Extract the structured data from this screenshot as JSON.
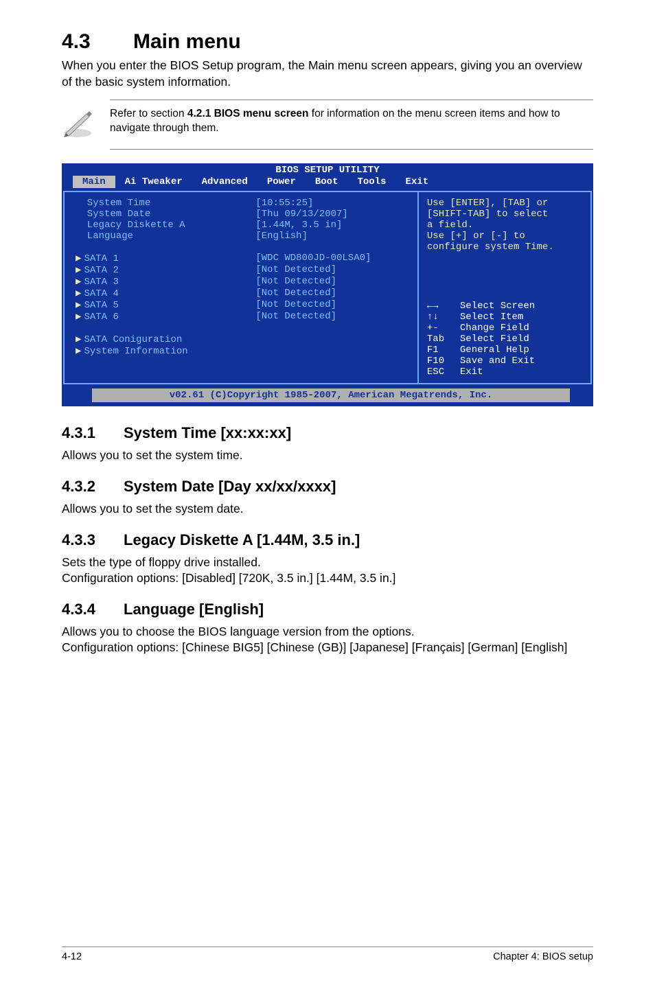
{
  "page": {
    "h2_num": "4.3",
    "h2_title": "Main menu",
    "intro": "When you enter the BIOS Setup program, the Main menu screen appears, giving you an overview of the basic system information.",
    "note_pre": "Refer to section ",
    "note_bold": "4.2.1  BIOS menu screen",
    "note_post": " for information on the menu screen items and how to navigate through them."
  },
  "bios": {
    "title": "BIOS SETUP UTILITY",
    "tabs": [
      "Main",
      "Ai Tweaker",
      "Advanced",
      "Power",
      "Boot",
      "Tools",
      "Exit"
    ],
    "selected_tab": "Main",
    "rows": [
      {
        "label": "System Time",
        "value": "[10:55:25]",
        "arrow": false
      },
      {
        "label": "System Date",
        "value": "[Thu 09/13/2007]",
        "arrow": false
      },
      {
        "label": "Legacy Diskette A",
        "value": "[1.44M, 3.5 in]",
        "arrow": false
      },
      {
        "label": "Language",
        "value": "[English]",
        "arrow": false
      },
      {
        "label": "",
        "value": "",
        "arrow": false
      },
      {
        "label": "SATA 1",
        "value": "[WDC WD800JD-00LSA0]",
        "arrow": true
      },
      {
        "label": "SATA 2",
        "value": "[Not Detected]",
        "arrow": true
      },
      {
        "label": "SATA 3",
        "value": "[Not Detected]",
        "arrow": true
      },
      {
        "label": "SATA 4",
        "value": "[Not Detected]",
        "arrow": true
      },
      {
        "label": "SATA 5",
        "value": "[Not Detected]",
        "arrow": true
      },
      {
        "label": "SATA 6",
        "value": "[Not Detected]",
        "arrow": true
      },
      {
        "label": "",
        "value": "",
        "arrow": false
      },
      {
        "label": "SATA Coniguration",
        "value": "",
        "arrow": true
      },
      {
        "label": "System Information",
        "value": "",
        "arrow": true
      }
    ],
    "help_top1": "Use [ENTER], [TAB] or",
    "help_top2": "[SHIFT-TAB] to select",
    "help_top3": "a field.",
    "help_top4": "",
    "help_top5": "Use [+] or [-] to",
    "help_top6": "configure system Time.",
    "hints": [
      {
        "key": "←→",
        "label": "Select Screen"
      },
      {
        "key": "↑↓",
        "label": "Select Item"
      },
      {
        "key": "+-",
        "label": "Change Field"
      },
      {
        "key": "Tab",
        "label": "Select Field"
      },
      {
        "key": "F1",
        "label": "General Help"
      },
      {
        "key": "F10",
        "label": "Save and Exit"
      },
      {
        "key": "ESC",
        "label": "Exit"
      }
    ],
    "footer": "v02.61 (C)Copyright 1985-2007, American Megatrends, Inc."
  },
  "sections": [
    {
      "num": "4.3.1",
      "title": "System Time [xx:xx:xx]",
      "body": "Allows you to set the system time."
    },
    {
      "num": "4.3.2",
      "title": "System Date [Day xx/xx/xxxx]",
      "body": "Allows you to set the system date."
    },
    {
      "num": "4.3.3",
      "title": "Legacy Diskette A [1.44M, 3.5 in.]",
      "body": "Sets the type of floppy drive installed.\nConfiguration options: [Disabled] [720K, 3.5 in.] [1.44M, 3.5 in.]"
    },
    {
      "num": "4.3.4",
      "title": "Language [English]",
      "body": "Allows you to choose the BIOS language version from the options.\nConfiguration options: [Chinese BIG5] [Chinese (GB)] [Japanese] [Français] [German] [English]"
    }
  ],
  "footer": {
    "left": "4-12",
    "right": "Chapter 4: BIOS setup"
  }
}
